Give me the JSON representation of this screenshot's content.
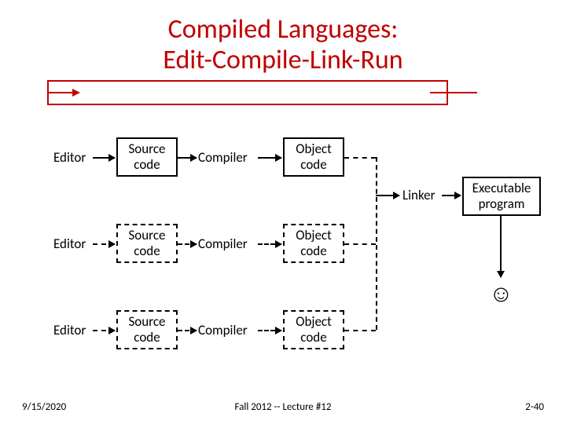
{
  "title_line1": "Compiled Languages:",
  "title_line2": "Edit-Compile-Link-Run",
  "rows": [
    {
      "editor": "Editor",
      "source": "Source\ncode",
      "compiler": "Compiler",
      "object": "Object\ncode"
    },
    {
      "editor": "Editor",
      "source": "Source\ncode",
      "compiler": "Compiler",
      "object": "Object\ncode"
    },
    {
      "editor": "Editor",
      "source": "Source\ncode",
      "compiler": "Compiler",
      "object": "Object\ncode"
    }
  ],
  "linker": "Linker",
  "executable": "Executable\nprogram",
  "smiley": "☺",
  "footer": {
    "date": "9/15/2020",
    "center": "Fall 2012 -- Lecture #12",
    "page": "2-40"
  }
}
